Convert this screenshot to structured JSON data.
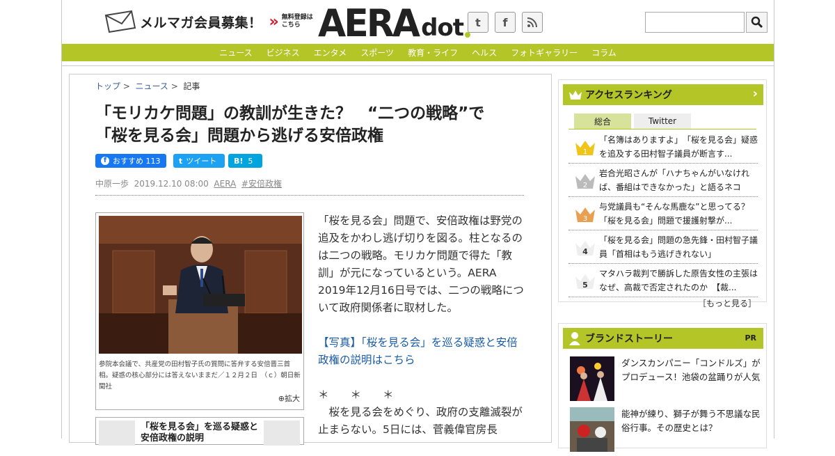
{
  "header": {
    "mailmag": "メルマガ会員募集！",
    "free_line1": "無料登録は",
    "free_line2": "こちら",
    "logo_main": "AERA",
    "logo_sub": "dot",
    "search_placeholder": ""
  },
  "nav": [
    "ニュース",
    "ビジネス",
    "エンタメ",
    "スポーツ",
    "教育・ライフ",
    "ヘルス",
    "フォトギャラリー",
    "コラム"
  ],
  "breadcrumb": [
    "トップ",
    "ニュース",
    "記事"
  ],
  "article": {
    "title_line1": "「モリカケ問題」の教訓が生きた？　“二つの戦略”で",
    "title_line2": "「桜を見る会」問題から逃げる安倍政権",
    "fb_label": "おすすめ",
    "fb_count": "113",
    "tweet_label": "ツイート",
    "hatena_label": "B!",
    "hatena_count": "5",
    "author": "中原一歩",
    "date": "2019.12.10 08:00",
    "source": "AERA",
    "tag": "#安倍政権",
    "photo_caption": "参院本会議で、共産党の田村智子氏の質問に答弁する安倍晋三首相。疑惑の核心部分には答えないままだ／１２月２日　（ｃ）朝日新聞社",
    "zoom_label": "拡大",
    "photo2_text_line1": "「桜を見る会」を巡る疑惑と",
    "photo2_text_line2": "安倍政権の説明",
    "body_p1": "「桜を見る会」問題で、安倍政権は野党の追及をかわし逃げ切りを図る。柱となるのは二つの戦略。モリカケ問題で得た「教訓」が元になっているという。AERA 2019年12月16日号では、二つの戦略について政府関係者に取材した。",
    "body_link": "【写真】「桜を見る会」を巡る疑惑と安倍政権の説明はこちら",
    "body_stars": "＊　　＊　　＊",
    "body_p2": "　桜を見る会をめぐり、政府の支離滅裂が止まらない。5日には、菅義偉官房長"
  },
  "ranking": {
    "heading": "アクセスランキング",
    "tab_all": "総合",
    "tab_twitter": "Twitter",
    "items": [
      {
        "rank": "1",
        "text": "「名簿はありますよ」　「桜を見る会」疑惑を追及する田村智子議員が断言す..."
      },
      {
        "rank": "2",
        "text": "岩合光昭さんが「ハナちゃんがいなければ、番組はできなかった」と語るネコ"
      },
      {
        "rank": "3",
        "text": "与党議員も“そんな馬鹿な”と思ってる？　「桜を見る会」問題で援護射撃が..."
      },
      {
        "rank": "4",
        "text": "「桜を見る会」問題の急先鋒・田村智子議員「首相はもう逃げきれない」"
      },
      {
        "rank": "5",
        "text": "マタハラ裁判で勝訴した原告女性の主張はなぜ、高裁で否定されたのか　【裁..."
      }
    ],
    "more": "［もっと見る］"
  },
  "brand": {
    "heading": "ブランドストーリー",
    "pr": "PR",
    "items": [
      {
        "text": "ダンスカンパニー「コンドルズ」がプロデュース！池袋の盆踊りが人気"
      },
      {
        "text": "能神が練り、獅子が舞う不思議な民俗行事。その歴史とは？"
      }
    ]
  },
  "colors": {
    "accent": "#b3c527",
    "link": "#3a5d9c",
    "fb": "#1877f2",
    "twitter": "#1da1f2",
    "hatena": "#00a4de",
    "mailmag_red": "#d41a2b"
  }
}
